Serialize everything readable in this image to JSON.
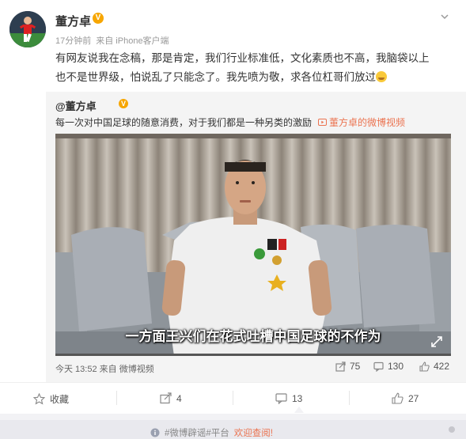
{
  "post": {
    "username": "董方卓",
    "time": "17分钟前",
    "source": "来自 iPhone客户端",
    "text": "有网友说我在念稿，那是肯定，我们行业标准低，文化素质也不高，我脑袋以上也不是世界级，怕说乱了只能念了。我先喷为敬，求各位杠哥们放过"
  },
  "repost": {
    "username": "@董方卓",
    "text": "每一次对中国足球的随意消费，对于我们都是一种另类的激励",
    "video_link": "董方卓的微博视频",
    "subtitle": "一方面王兴们在花式吐槽中国足球的不作为",
    "time_source": "今天 13:52 来自 微博视频",
    "reposts": "75",
    "comments": "130",
    "likes": "422"
  },
  "footer": {
    "favorite": "收藏",
    "repost": "4",
    "comment": "13",
    "like": "27"
  },
  "bottom_bar": {
    "tag": "#微博辟谣#平台",
    "cta": "欢迎查阅!"
  },
  "colors": {
    "accent": "#eb7350",
    "verified": "#f7a600"
  }
}
